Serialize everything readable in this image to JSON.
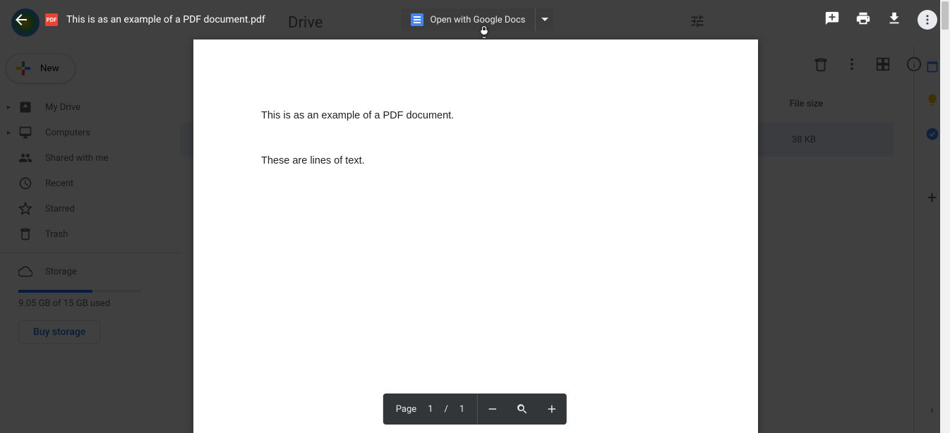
{
  "drive": {
    "title": "Drive",
    "new_label": "New",
    "nav": {
      "my_drive": "My Drive",
      "computers": "Computers",
      "shared": "Shared with me",
      "recent": "Recent",
      "starred": "Starred",
      "trash": "Trash",
      "storage": "Storage"
    },
    "storage_text": "9.05 GB of 15 GB used",
    "buy_storage": "Buy storage",
    "column_header": "File size",
    "file_size_value": "38 KB"
  },
  "viewer": {
    "pdf_badge": "PDF",
    "file_name": "This is as an example of a PDF document.pdf",
    "open_with_label": "Open with Google Docs",
    "document": {
      "line1": "This is as an example of a PDF document.",
      "line2": "These are lines of text."
    },
    "controls": {
      "page_label": "Page",
      "current": "1",
      "separator": "/",
      "total": "1"
    }
  }
}
